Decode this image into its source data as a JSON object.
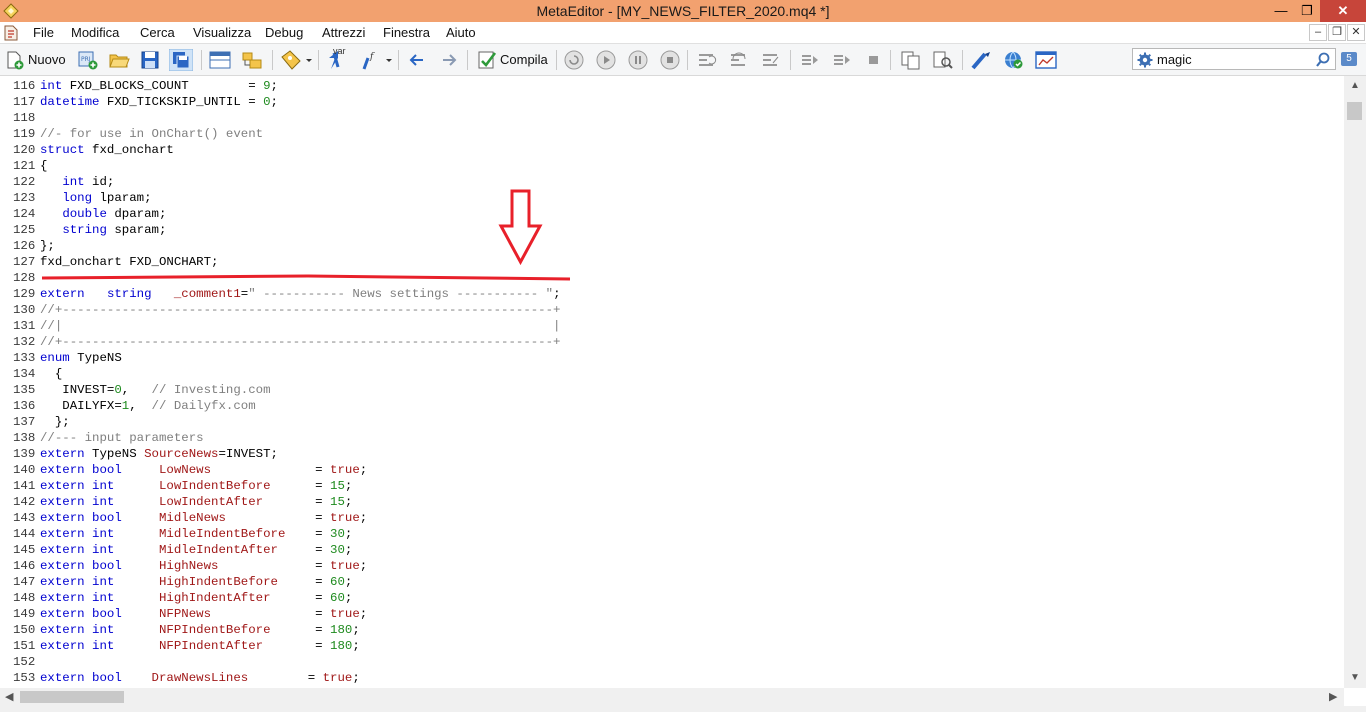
{
  "window": {
    "title": "MetaEditor - [MY_NEWS_FILTER_2020.mq4 *]",
    "minimize": "—",
    "maximize": "❐",
    "close": "✕"
  },
  "menu": {
    "items": [
      "File",
      "Modifica",
      "Cerca",
      "Visualizza",
      "Debug",
      "Attrezzi",
      "Finestra",
      "Aiuto"
    ],
    "mdi_min": "–",
    "mdi_restore": "❐",
    "mdi_close": "✕"
  },
  "toolbar": {
    "new_label": "Nuovo",
    "compile_label": "Compila",
    "var_label": "var",
    "search_value": "magic",
    "result_count": "5"
  },
  "code": {
    "lines": [
      {
        "n": "116",
        "segs": [
          [
            "kw",
            "int"
          ],
          [
            "tx",
            " FXD_BLOCKS_COUNT        = "
          ],
          [
            "num",
            "9"
          ],
          [
            "tx",
            ";"
          ]
        ]
      },
      {
        "n": "117",
        "segs": [
          [
            "kw",
            "datetime"
          ],
          [
            "tx",
            " FXD_TICKSKIP_UNTIL = "
          ],
          [
            "num",
            "0"
          ],
          [
            "tx",
            ";"
          ]
        ]
      },
      {
        "n": "118",
        "segs": []
      },
      {
        "n": "119",
        "segs": [
          [
            "cm",
            "//- for use in OnChart() event"
          ]
        ]
      },
      {
        "n": "120",
        "segs": [
          [
            "kw",
            "struct"
          ],
          [
            "tx",
            " fxd_onchart"
          ]
        ]
      },
      {
        "n": "121",
        "segs": [
          [
            "tx",
            "{"
          ]
        ]
      },
      {
        "n": "122",
        "segs": [
          [
            "tx",
            "   "
          ],
          [
            "kw",
            "int"
          ],
          [
            "tx",
            " id;"
          ]
        ]
      },
      {
        "n": "123",
        "segs": [
          [
            "tx",
            "   "
          ],
          [
            "kw",
            "long"
          ],
          [
            "tx",
            " lparam;"
          ]
        ]
      },
      {
        "n": "124",
        "segs": [
          [
            "tx",
            "   "
          ],
          [
            "kw",
            "double"
          ],
          [
            "tx",
            " dparam;"
          ]
        ]
      },
      {
        "n": "125",
        "segs": [
          [
            "tx",
            "   "
          ],
          [
            "kw",
            "string"
          ],
          [
            "tx",
            " sparam;"
          ]
        ]
      },
      {
        "n": "126",
        "segs": [
          [
            "tx",
            "};"
          ]
        ]
      },
      {
        "n": "127",
        "segs": [
          [
            "tx",
            "fxd_onchart FXD_ONCHART;"
          ]
        ]
      },
      {
        "n": "128",
        "segs": []
      },
      {
        "n": "129",
        "segs": [
          [
            "kw",
            "extern"
          ],
          [
            "tx",
            "   "
          ],
          [
            "kw",
            "string"
          ],
          [
            "tx",
            "   "
          ],
          [
            "var",
            "_comment1"
          ],
          [
            "tx",
            "="
          ],
          [
            "str",
            "\" ----------- News settings ----------- \""
          ],
          [
            "tx",
            ";"
          ]
        ]
      },
      {
        "n": "130",
        "segs": [
          [
            "cm",
            "//+------------------------------------------------------------------+"
          ]
        ]
      },
      {
        "n": "131",
        "segs": [
          [
            "cm",
            "//|                                                                  |"
          ]
        ]
      },
      {
        "n": "132",
        "segs": [
          [
            "cm",
            "//+------------------------------------------------------------------+"
          ]
        ]
      },
      {
        "n": "133",
        "segs": [
          [
            "kw",
            "enum"
          ],
          [
            "tx",
            " TypeNS"
          ]
        ]
      },
      {
        "n": "134",
        "segs": [
          [
            "tx",
            "  {"
          ]
        ]
      },
      {
        "n": "135",
        "segs": [
          [
            "tx",
            "   INVEST="
          ],
          [
            "num",
            "0"
          ],
          [
            "tx",
            ",   "
          ],
          [
            "cm",
            "// Investing.com"
          ]
        ]
      },
      {
        "n": "136",
        "segs": [
          [
            "tx",
            "   DAILYFX="
          ],
          [
            "num",
            "1"
          ],
          [
            "tx",
            ",  "
          ],
          [
            "cm",
            "// Dailyfx.com"
          ]
        ]
      },
      {
        "n": "137",
        "segs": [
          [
            "tx",
            "  };"
          ]
        ]
      },
      {
        "n": "138",
        "segs": [
          [
            "cm",
            "//--- input parameters"
          ]
        ]
      },
      {
        "n": "139",
        "segs": [
          [
            "kw",
            "extern"
          ],
          [
            "tx",
            " TypeNS "
          ],
          [
            "var",
            "SourceNews"
          ],
          [
            "tx",
            "=INVEST;"
          ]
        ]
      },
      {
        "n": "140",
        "segs": [
          [
            "kw",
            "extern bool"
          ],
          [
            "tx",
            "     "
          ],
          [
            "var",
            "LowNews"
          ],
          [
            "tx",
            "              = "
          ],
          [
            "var",
            "true"
          ],
          [
            "tx",
            ";"
          ]
        ]
      },
      {
        "n": "141",
        "segs": [
          [
            "kw",
            "extern int"
          ],
          [
            "tx",
            "      "
          ],
          [
            "var",
            "LowIndentBefore"
          ],
          [
            "tx",
            "      = "
          ],
          [
            "num",
            "15"
          ],
          [
            "tx",
            ";"
          ]
        ]
      },
      {
        "n": "142",
        "segs": [
          [
            "kw",
            "extern int"
          ],
          [
            "tx",
            "      "
          ],
          [
            "var",
            "LowIndentAfter"
          ],
          [
            "tx",
            "       = "
          ],
          [
            "num",
            "15"
          ],
          [
            "tx",
            ";"
          ]
        ]
      },
      {
        "n": "143",
        "segs": [
          [
            "kw",
            "extern bool"
          ],
          [
            "tx",
            "     "
          ],
          [
            "var",
            "MidleNews"
          ],
          [
            "tx",
            "            = "
          ],
          [
            "var",
            "true"
          ],
          [
            "tx",
            ";"
          ]
        ]
      },
      {
        "n": "144",
        "segs": [
          [
            "kw",
            "extern int"
          ],
          [
            "tx",
            "      "
          ],
          [
            "var",
            "MidleIndentBefore"
          ],
          [
            "tx",
            "    = "
          ],
          [
            "num",
            "30"
          ],
          [
            "tx",
            ";"
          ]
        ]
      },
      {
        "n": "145",
        "segs": [
          [
            "kw",
            "extern int"
          ],
          [
            "tx",
            "      "
          ],
          [
            "var",
            "MidleIndentAfter"
          ],
          [
            "tx",
            "     = "
          ],
          [
            "num",
            "30"
          ],
          [
            "tx",
            ";"
          ]
        ]
      },
      {
        "n": "146",
        "segs": [
          [
            "kw",
            "extern bool"
          ],
          [
            "tx",
            "     "
          ],
          [
            "var",
            "HighNews"
          ],
          [
            "tx",
            "             = "
          ],
          [
            "var",
            "true"
          ],
          [
            "tx",
            ";"
          ]
        ]
      },
      {
        "n": "147",
        "segs": [
          [
            "kw",
            "extern int"
          ],
          [
            "tx",
            "      "
          ],
          [
            "var",
            "HighIndentBefore"
          ],
          [
            "tx",
            "     = "
          ],
          [
            "num",
            "60"
          ],
          [
            "tx",
            ";"
          ]
        ]
      },
      {
        "n": "148",
        "segs": [
          [
            "kw",
            "extern int"
          ],
          [
            "tx",
            "      "
          ],
          [
            "var",
            "HighIndentAfter"
          ],
          [
            "tx",
            "      = "
          ],
          [
            "num",
            "60"
          ],
          [
            "tx",
            ";"
          ]
        ]
      },
      {
        "n": "149",
        "segs": [
          [
            "kw",
            "extern bool"
          ],
          [
            "tx",
            "     "
          ],
          [
            "var",
            "NFPNews"
          ],
          [
            "tx",
            "              = "
          ],
          [
            "var",
            "true"
          ],
          [
            "tx",
            ";"
          ]
        ]
      },
      {
        "n": "150",
        "segs": [
          [
            "kw",
            "extern int"
          ],
          [
            "tx",
            "      "
          ],
          [
            "var",
            "NFPIndentBefore"
          ],
          [
            "tx",
            "      = "
          ],
          [
            "num",
            "180"
          ],
          [
            "tx",
            ";"
          ]
        ]
      },
      {
        "n": "151",
        "segs": [
          [
            "kw",
            "extern int"
          ],
          [
            "tx",
            "      "
          ],
          [
            "var",
            "NFPIndentAfter"
          ],
          [
            "tx",
            "       = "
          ],
          [
            "num",
            "180"
          ],
          [
            "tx",
            ";"
          ]
        ]
      },
      {
        "n": "152",
        "segs": []
      },
      {
        "n": "153",
        "segs": [
          [
            "kw",
            "extern bool"
          ],
          [
            "tx",
            "    "
          ],
          [
            "var",
            "DrawNewsLines"
          ],
          [
            "tx",
            "        = "
          ],
          [
            "var",
            "true"
          ],
          [
            "tx",
            ";"
          ]
        ]
      }
    ]
  },
  "colors": {
    "titlebar": "#f2a16f",
    "keyword": "#0000d0",
    "comment": "#7f7f7f",
    "number": "#1e8a1e",
    "identifier": "#a01818",
    "annotation": "#e8202a"
  }
}
